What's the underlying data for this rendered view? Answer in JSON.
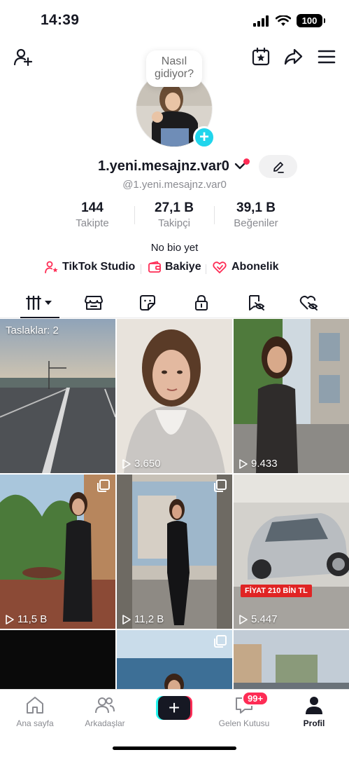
{
  "status_bar": {
    "time": "14:39",
    "battery": "100"
  },
  "profile": {
    "bubble_text": "Nasıl gidiyor?",
    "username": "1.yeni.mesajnz.var0",
    "handle": "@1.yeni.mesajnz.var0",
    "stats": [
      {
        "value": "144",
        "label": "Takipte"
      },
      {
        "value": "27,1 B",
        "label": "Takipçi"
      },
      {
        "value": "39,1 B",
        "label": "Beğeniler"
      }
    ],
    "bio": "No bio yet",
    "links": [
      {
        "label": "TikTok Studio",
        "icon": "person-star-icon"
      },
      {
        "label": "Bakiye",
        "icon": "wallet-icon"
      },
      {
        "label": "Abonelik",
        "icon": "heart-badge-icon"
      }
    ]
  },
  "tabs": [
    {
      "name": "videos",
      "icon": "grid-bars-icon",
      "active": true
    },
    {
      "name": "shop",
      "icon": "shop-icon"
    },
    {
      "name": "stickers",
      "icon": "sticker-icon"
    },
    {
      "name": "private",
      "icon": "lock-icon"
    },
    {
      "name": "reposts",
      "icon": "bookmark-eye-icon"
    },
    {
      "name": "liked",
      "icon": "heart-eye-icon"
    }
  ],
  "grid": {
    "drafts_label": "Taslaklar: 2",
    "items": [
      {
        "views": ""
      },
      {
        "views": "3.650"
      },
      {
        "views": "9.433"
      },
      {
        "views": "11,5 B"
      },
      {
        "views": "11,2 B"
      },
      {
        "views": "5.447",
        "overlay": "FİYAT 210 BİN TL"
      }
    ]
  },
  "bottom_nav": {
    "home": "Ana sayfa",
    "friends": "Arkadaşlar",
    "inbox": "Gelen Kutusu",
    "inbox_badge": "99+",
    "profile": "Profil"
  },
  "colors": {
    "accent": "#fe2c55",
    "cyan": "#25f4ee",
    "avatar_plus": "#20d5ec",
    "text": "#161823",
    "muted": "#8a8b91"
  }
}
